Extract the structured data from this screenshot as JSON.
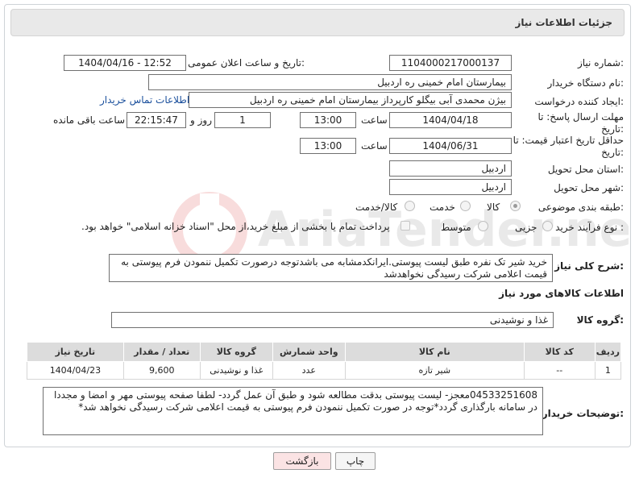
{
  "header": {
    "title": "جزئیات اطلاعات نیاز"
  },
  "fields": {
    "need_number_label": "شماره نیاز:",
    "need_number_value": "1104000217000137",
    "announce_label": "تاریخ و ساعت اعلان عمومی:",
    "announce_value": "1404/04/16 - 12:52",
    "buyer_org_label": "نام دستگاه خریدار:",
    "buyer_org_value": "بیمارستان امام خمینی  ره  اردبیل",
    "creator_label": "ایجاد کننده درخواست:",
    "creator_value": "بیژن محمدی آبی بیگلو کارپرداز بیمارستان امام خمینی  ره  اردبیل",
    "contact_link": "اطلاعات تماس خریدار",
    "deadline_label": "مهلت ارسال پاسخ: تا تاریخ:",
    "deadline_date": "1404/04/18",
    "time_label": "ساعت",
    "deadline_time": "13:00",
    "days_value": "1",
    "days_and_label": "روز و",
    "remaining_time": "22:15:47",
    "remaining_label": "ساعت باقی مانده",
    "validity_label": "حداقل تاریخ اعتبار قیمت: تا تاریخ:",
    "validity_date": "1404/06/31",
    "validity_time": "13:00",
    "province_label": "استان محل تحویل:",
    "province_value": "اردبیل",
    "city_label": "شهر محل تحویل:",
    "city_value": "اردبیل",
    "category_label": "طبقه بندی موضوعی:",
    "category_options": [
      "کالا",
      "خدمت",
      "کالا/خدمت"
    ],
    "process_label": "نوع فرآیند خرید :",
    "process_options": [
      "جزیی",
      "متوسط"
    ],
    "payment_note": "پرداخت تمام یا بخشی از مبلغ خرید،از محل \"اسناد خزانه اسلامی\" خواهد بود."
  },
  "description": {
    "label": "شرح کلی نیاز:",
    "text": "خرید شیر تک نفره طبق لیست پیوستی.ایرانکدمشابه می باشدتوجه درصورت تکمیل ننمودن فرم پیوستی به قیمت اعلامی شرکت رسیدگی نخواهدشد"
  },
  "goods": {
    "section_title": "اطلاعات کالاهای مورد نیاز",
    "group_label": "گروه کالا:",
    "group_value": "غذا و نوشیدنی",
    "table": {
      "headers": [
        "ردیف",
        "کد کالا",
        "نام کالا",
        "واحد شمارش",
        "گروه کالا",
        "تعداد / مقدار",
        "تاریخ نیاز"
      ],
      "rows": [
        [
          "1",
          "--",
          "شیر تازه",
          "عدد",
          "غذا و نوشیدنی",
          "9,600",
          "1404/04/23"
        ]
      ]
    }
  },
  "buyer_notes": {
    "label": "توضیحات خریدار:",
    "text": "04533251608معجز- لیست پیوستی بدقت مطالعه شود و طبق آن عمل گردد- لطفا صفحه پیوستی مهر و امضا و مجددا در سامانه بارگذاری گردد*توجه در صورت تکمیل ننمودن فرم پیوستی به قیمت اعلامی شرکت رسیدگی نخواهد شد*"
  },
  "buttons": {
    "back": "بازگشت",
    "print": "چاپ"
  },
  "watermark_text": "AriaTender.neT",
  "colors": {
    "link": "#1a4f9c",
    "back_button_bg": "#fbe3e4",
    "header_bg": "#e9e9e9"
  }
}
